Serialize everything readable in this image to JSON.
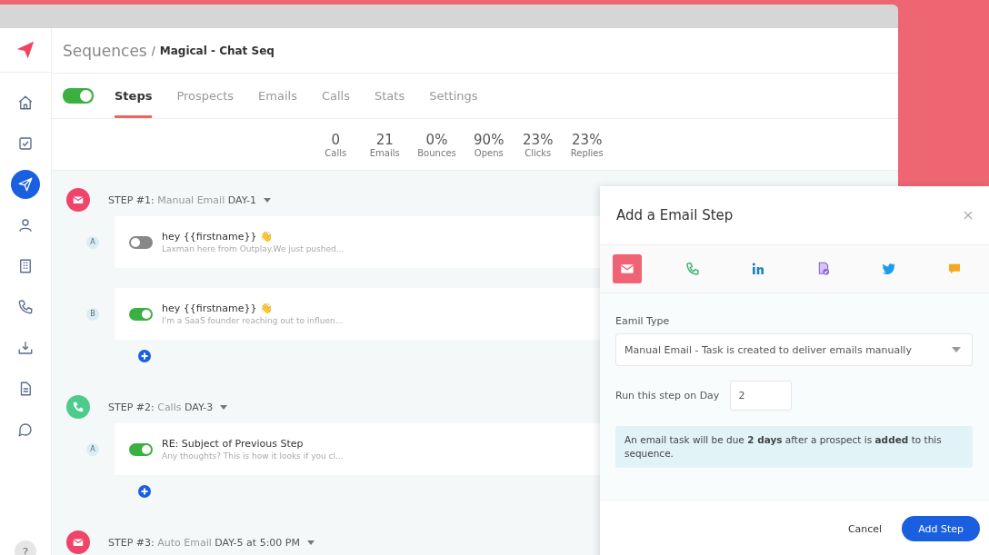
{
  "breadcrumb": {
    "root": "Sequences",
    "separator": "/",
    "current": "Magical - Chat Seq"
  },
  "sidebar": {
    "items": [
      {
        "kind": "home",
        "selected": false
      },
      {
        "kind": "tasks",
        "selected": false
      },
      {
        "kind": "sequences",
        "selected": true
      },
      {
        "kind": "person",
        "selected": false
      },
      {
        "kind": "building",
        "selected": false
      },
      {
        "kind": "phone",
        "selected": false
      },
      {
        "kind": "inbox",
        "selected": false
      },
      {
        "kind": "document",
        "selected": false
      },
      {
        "kind": "chat",
        "selected": false
      }
    ],
    "help": "?"
  },
  "sequence_toggle": {
    "on": true
  },
  "tabs": [
    {
      "label": "Steps",
      "selected": true
    },
    {
      "label": "Prospects",
      "selected": false
    },
    {
      "label": "Emails",
      "selected": false
    },
    {
      "label": "Calls",
      "selected": false
    },
    {
      "label": "Stats",
      "selected": false
    },
    {
      "label": "Settings",
      "selected": false
    }
  ],
  "stats": [
    {
      "value": "0",
      "label": "Calls"
    },
    {
      "value": "21",
      "label": "Emails"
    },
    {
      "value": "0%",
      "label": "Bounces"
    },
    {
      "value": "90%",
      "label": "Opens"
    },
    {
      "value": "23%",
      "label": "Clicks"
    },
    {
      "value": "23%",
      "label": "Replies"
    }
  ],
  "steps": [
    {
      "kind": "email",
      "number": "STEP #1:",
      "type": "Manual Email",
      "day": "DAY-1",
      "variants": [
        {
          "letter": "A",
          "on": false,
          "subject": "hey {{firstname}} 👋",
          "preview": "Laxman here from Outplay.We just pushed..."
        },
        {
          "letter": "B",
          "on": true,
          "subject": "hey {{firstname}} 👋",
          "preview": "I'm a SaaS founder reaching out to influen..."
        }
      ]
    },
    {
      "kind": "call",
      "number": "STEP #2:",
      "type": "Calls",
      "day": "DAY-3",
      "variants": [
        {
          "letter": "A",
          "on": true,
          "subject": "RE: Subject of Previous Step",
          "preview": "Any thoughts? This is how it looks if you cl..."
        }
      ]
    },
    {
      "kind": "email",
      "number": "STEP #3:",
      "type": "Auto Email",
      "day": "DAY-5 at 5:00 PM"
    }
  ],
  "dialog": {
    "title": "Add a Email Step",
    "channels": [
      {
        "kind": "email",
        "selected": true
      },
      {
        "kind": "call",
        "selected": false
      },
      {
        "kind": "linkedin",
        "selected": false
      },
      {
        "kind": "task",
        "selected": false
      },
      {
        "kind": "twitter",
        "selected": false
      },
      {
        "kind": "sms",
        "selected": false
      }
    ],
    "type_label": "Eamil Type",
    "type_value": "Manual Email - Task is created to deliver emails manually",
    "day_label": "Run this step on Day",
    "day_value": "2",
    "info": "An email task will be due **2 days** after a prospect is **added** to this sequence.",
    "cancel": "Cancel",
    "submit": "Add Step"
  }
}
